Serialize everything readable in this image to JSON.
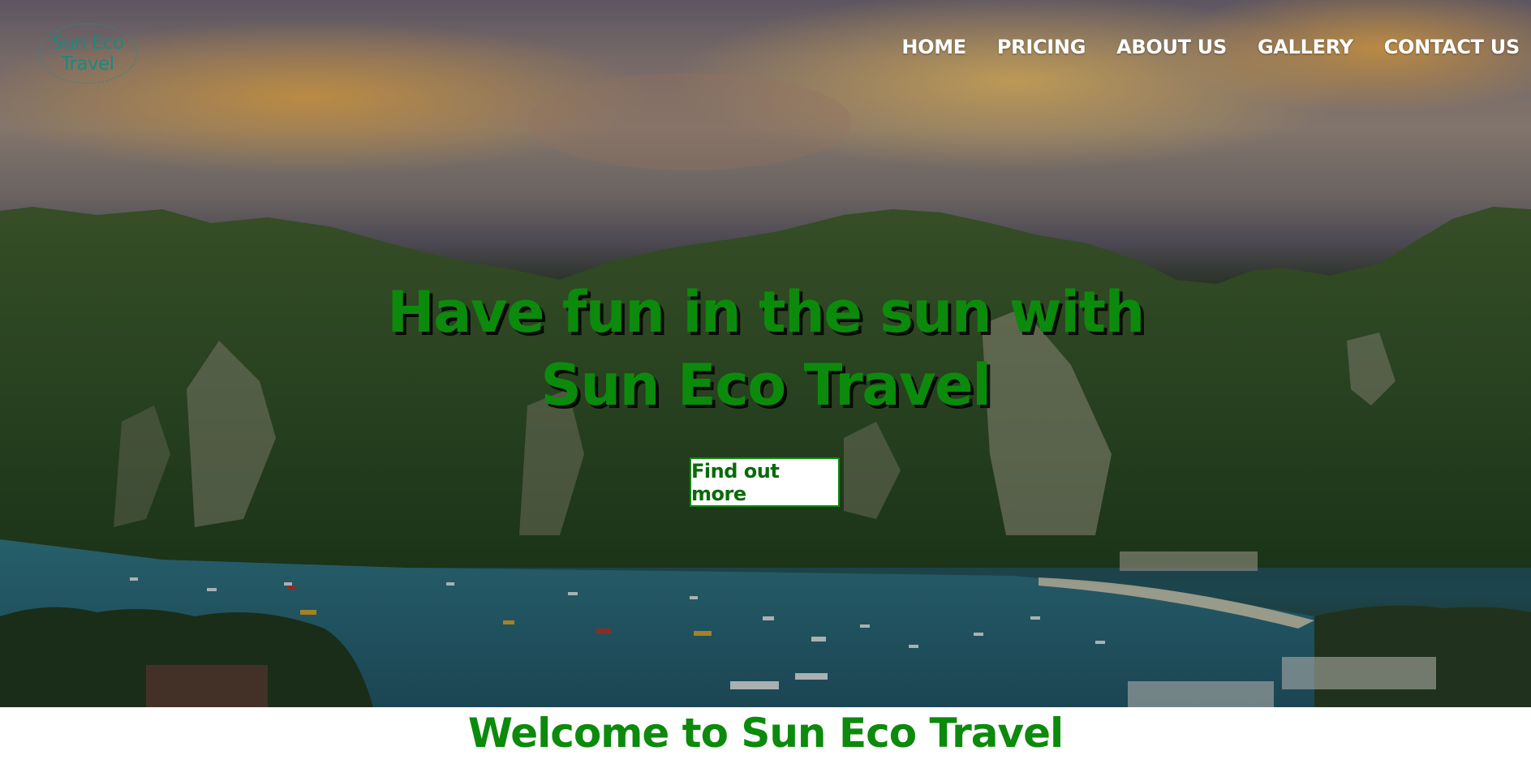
{
  "logo": {
    "line1": "Sun Eco",
    "line2": "Travel"
  },
  "nav": [
    {
      "label": "HOME"
    },
    {
      "label": "PRICING"
    },
    {
      "label": "ABOUT US"
    },
    {
      "label": "GALLERY"
    },
    {
      "label": "CONTACT US"
    }
  ],
  "hero": {
    "headline_line1": "Have fun in the sun with",
    "headline_line2": "Sun Eco Travel",
    "cta_label": "Find out more",
    "background": "tropical-bay-photo"
  },
  "welcome": {
    "title": "Welcome to Sun Eco Travel"
  },
  "colors": {
    "brand_green": "#0c8a0c",
    "logo_teal": "#1a8a7c",
    "nav_text": "#ffffff"
  }
}
